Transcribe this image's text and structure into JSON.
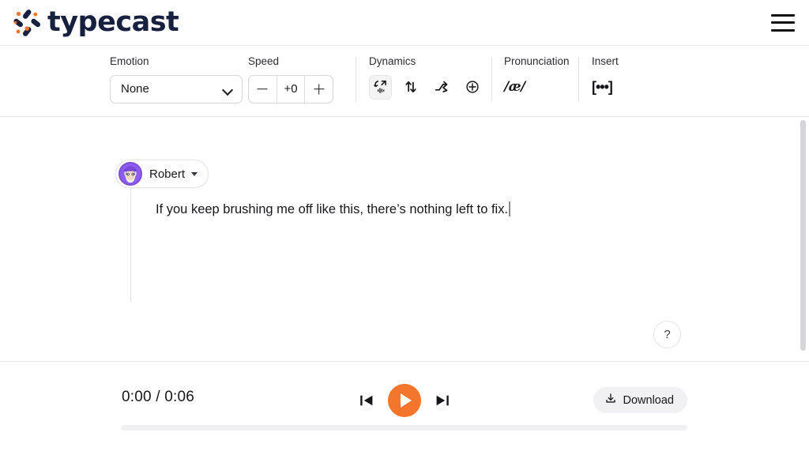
{
  "header": {
    "brand_name": "typecast",
    "brand_icon": "typecast-logo-icon",
    "menu_icon": "hamburger-menu-icon"
  },
  "toolbar": {
    "groups": [
      {
        "label": "Emotion",
        "type": "select",
        "value": "None",
        "placeholder": "None"
      },
      {
        "label": "Speed",
        "type": "stepper",
        "decrement": "−",
        "value": "+0",
        "increment": "+"
      },
      {
        "label": "Dynamics",
        "type": "icons",
        "icons": [
          {
            "name": "intonation-icon",
            "selected": true
          },
          {
            "name": "pitch-icon",
            "selected": false
          },
          {
            "name": "tempo-icon",
            "selected": false
          },
          {
            "name": "add-dynamics-icon",
            "selected": false
          }
        ]
      },
      {
        "label": "Pronunciation",
        "type": "glyph",
        "glyph": "/æ/",
        "icon_name": "pronunciation-ipa-icon"
      },
      {
        "label": "Insert",
        "type": "glyph",
        "glyph": "[•••]",
        "icon_name": "insert-pause-icon"
      }
    ]
  },
  "editor": {
    "speaker": {
      "name": "Robert",
      "avatar_name": "speaker-avatar",
      "avatar_ring_color": "#7e4fd4"
    },
    "script_text": "If you keep brushing me off like this, there’s nothing left to fix.",
    "help_label": "?"
  },
  "player": {
    "current_time": "0:00",
    "total_time": "0:06",
    "time_display": "0:00 / 0:06",
    "skip_back_icon": "skip-back-icon",
    "play_icon": "play-icon",
    "skip_forward_icon": "skip-forward-icon",
    "download_label": "Download",
    "download_icon": "download-icon",
    "progress_percent": 0
  },
  "colors": {
    "accent_orange": "#f4762c",
    "brand_navy": "#17203f",
    "avatar_purple": "#7e4fd4",
    "border_gray": "#e6e6e8"
  }
}
